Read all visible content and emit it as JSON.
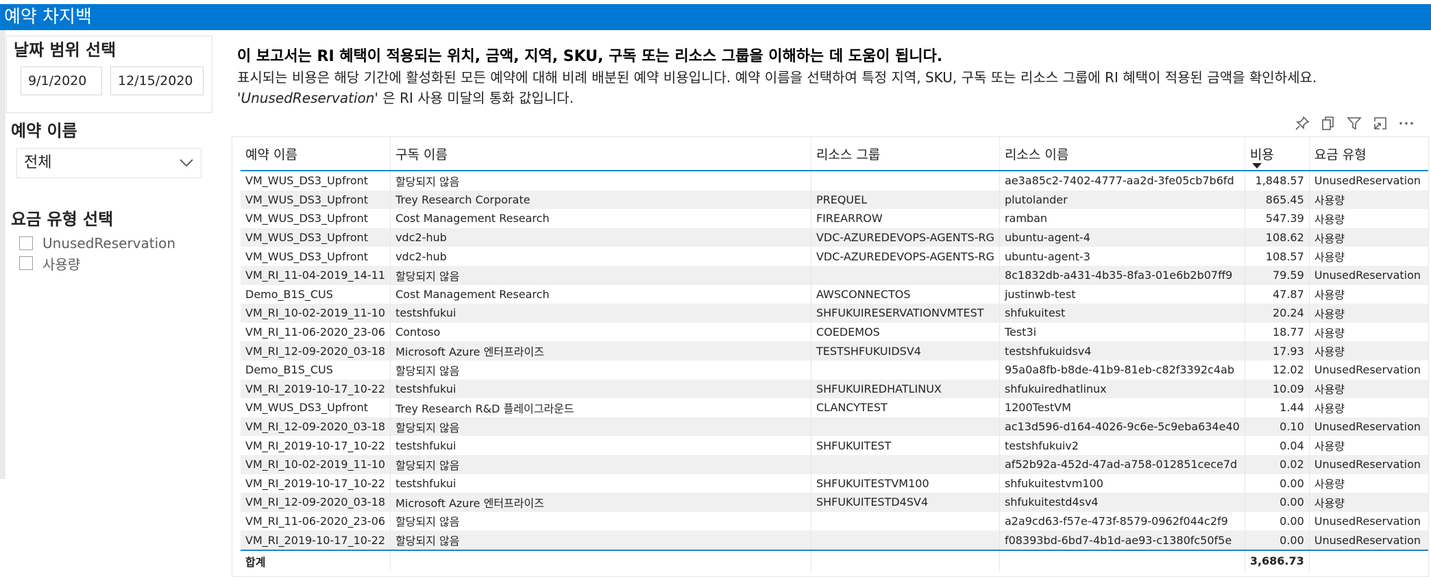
{
  "title": "예약 차지백",
  "date_panel": {
    "title": "날짜 범위 선택",
    "start_date": "9/1/2020",
    "end_date": "12/15/2020"
  },
  "reservation_filter": {
    "title": "예약 이름",
    "selected": "전체"
  },
  "charge_type_filter": {
    "title": "요금 유형 선택",
    "options": [
      "UnusedReservation",
      "사용량"
    ]
  },
  "description": {
    "headline": "이 보고서는 RI 혜택이 적용되는 위치, 금액, 지역, SKU, 구독 또는 리소스 그룹을 이해하는 데 도움이 됩니다.",
    "body_prefix": "표시되는 비용은 해당 기간에 활성화된 모든 예약에 대해 비례 배분된 예약 비용입니다. 예약 이름을 선택하여 특정 지역, SKU, 구독 또는 리소스 그룹에 RI 혜택이 적용된 금액을 확인하세요. ",
    "body_italic": "'UnusedReservation'",
    "body_suffix": " 은 RI 사용 미달의 통화 값입니다."
  },
  "visual_icons": [
    "pin-icon",
    "copy-icon",
    "filter-icon",
    "focus-mode-icon",
    "more-options-icon"
  ],
  "table": {
    "columns": [
      "예약 이름",
      "구독 이름",
      "리소스 그룹",
      "리소스 이름",
      "비용",
      "요금 유형"
    ],
    "sort_column": "비용",
    "rows": [
      [
        "VM_WUS_DS3_Upfront",
        "할당되지 않음",
        "",
        "ae3a85c2-7402-4777-aa2d-3fe05cb7b6fd",
        "1,848.57",
        "UnusedReservation"
      ],
      [
        "VM_WUS_DS3_Upfront",
        "Trey Research Corporate",
        "PREQUEL",
        "plutolander",
        "865.45",
        "사용량"
      ],
      [
        "VM_WUS_DS3_Upfront",
        "Cost Management Research",
        "FIREARROW",
        "ramban",
        "547.39",
        "사용량"
      ],
      [
        "VM_WUS_DS3_Upfront",
        "vdc2-hub",
        "VDC-AZUREDEVOPS-AGENTS-RG",
        "ubuntu-agent-4",
        "108.62",
        "사용량"
      ],
      [
        "VM_WUS_DS3_Upfront",
        "vdc2-hub",
        "VDC-AZUREDEVOPS-AGENTS-RG",
        "ubuntu-agent-3",
        "108.57",
        "사용량"
      ],
      [
        "VM_RI_11-04-2019_14-11",
        "할당되지 않음",
        "",
        "8c1832db-a431-4b35-8fa3-01e6b2b07ff9",
        "79.59",
        "UnusedReservation"
      ],
      [
        "Demo_B1S_CUS",
        "Cost Management Research",
        "AWSCONNECTOS",
        "justinwb-test",
        "47.87",
        "사용량"
      ],
      [
        "VM_RI_10-02-2019_11-10",
        "testshfukui",
        "SHFUKUIRESERVATIONVMTEST",
        "shfukuitest",
        "20.24",
        "사용량"
      ],
      [
        "VM_RI_11-06-2020_23-06",
        "Contoso",
        "COEDEMOS",
        "Test3i",
        "18.77",
        "사용량"
      ],
      [
        "VM_RI_12-09-2020_03-18",
        "Microsoft Azure 엔터프라이즈",
        "TESTSHFUKUIDSV4",
        "testshfukuidsv4",
        "17.93",
        "사용량"
      ],
      [
        "Demo_B1S_CUS",
        "할당되지 않음",
        "",
        "95a0a8fb-b8de-41b9-81eb-c82f3392c4ab",
        "12.02",
        "UnusedReservation"
      ],
      [
        "VM_RI_2019-10-17_10-22",
        "testshfukui",
        "SHFUKUIREDHATLINUX",
        "shfukuiredhatlinux",
        "10.09",
        "사용량"
      ],
      [
        "VM_WUS_DS3_Upfront",
        "Trey Research R&D 플레이그라운드",
        "CLANCYTEST",
        "1200TestVM",
        "1.44",
        "사용량"
      ],
      [
        "VM_RI_12-09-2020_03-18",
        "할당되지 않음",
        "",
        "ac13d596-d164-4026-9c6e-5c9eba634e40",
        "0.10",
        "UnusedReservation"
      ],
      [
        "VM_RI_2019-10-17_10-22",
        "testshfukui",
        "SHFUKUITEST",
        "testshfukuiv2",
        "0.04",
        "사용량"
      ],
      [
        "VM_RI_10-02-2019_11-10",
        "할당되지 않음",
        "",
        "af52b92a-452d-47ad-a758-012851cece7d",
        "0.02",
        "UnusedReservation"
      ],
      [
        "VM_RI_2019-10-17_10-22",
        "testshfukui",
        "SHFUKUITESTVM100",
        "shfukuitestvm100",
        "0.00",
        "사용량"
      ],
      [
        "VM_RI_12-09-2020_03-18",
        "Microsoft Azure 엔터프라이즈",
        "SHFUKUITESTD4SV4",
        "shfukuitestd4sv4",
        "0.00",
        "사용량"
      ],
      [
        "VM_RI_11-06-2020_23-06",
        "할당되지 않음",
        "",
        "a2a9cd63-f57e-473f-8579-0962f044c2f9",
        "0.00",
        "UnusedReservation"
      ],
      [
        "VM_RI_2019-10-17_10-22",
        "할당되지 않음",
        "",
        "f08393bd-6bd7-4b1d-ae93-c1380fc50f5e",
        "0.00",
        "UnusedReservation"
      ]
    ],
    "total_label": "합계",
    "total_value": "3,686.73"
  }
}
